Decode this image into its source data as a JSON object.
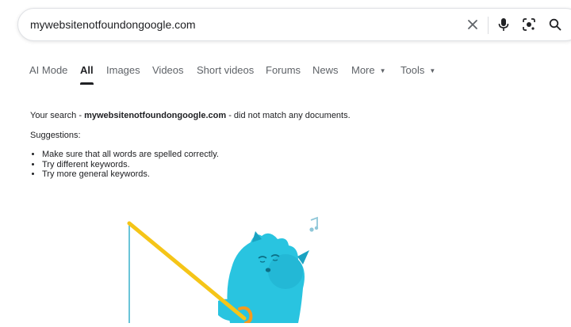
{
  "search": {
    "query": "mywebsitenotfoundongoogle.com",
    "clear_icon": "close-icon",
    "voice_icon": "microphone-icon",
    "lens_icon": "camera-lens-icon",
    "search_icon": "search-icon"
  },
  "tabs": [
    {
      "label": "AI Mode"
    },
    {
      "label": "All",
      "active": true
    },
    {
      "label": "Images"
    },
    {
      "label": "Videos"
    },
    {
      "label": "Short videos"
    },
    {
      "label": "Forums"
    },
    {
      "label": "News"
    },
    {
      "label": "More",
      "dropdown": true
    },
    {
      "label": "Tools",
      "dropdown": true
    }
  ],
  "results": {
    "prefix": "Your search - ",
    "query": "mywebsitenotfoundongoogle.com",
    "suffix": " - did not match any documents.",
    "suggestions_label": "Suggestions:",
    "suggestions": [
      "Make sure that all words are spelled correctly.",
      "Try different keywords.",
      "Try more general keywords."
    ]
  },
  "colors": {
    "accent": "#202124",
    "muted": "#5f6368",
    "creature": "#29c4e0",
    "fishing_rod": "#f5c518",
    "creature_arm": "#f59a1e"
  }
}
